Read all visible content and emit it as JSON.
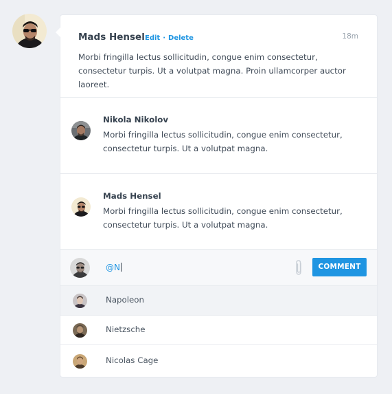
{
  "main_comment": {
    "author": "Mads Hensel",
    "actions": {
      "edit": "Edit",
      "separator": "·",
      "delete": "Delete"
    },
    "time": "18m",
    "text": "Morbi fringilla lectus sollicitudin, congue enim consectetur, consectetur turpis. Ut a volutpat magna. Proin ullamcorper auctor laoreet."
  },
  "replies": [
    {
      "author": "Nikola Nikolov",
      "text": "Morbi fringilla lectus sollicitudin, congue enim consectetur, consectetur turpis. Ut a volutpat magna."
    },
    {
      "author": "Mads Hensel",
      "text": "Morbi fringilla lectus sollicitudin, congue enim consectetur, consectetur turpis. Ut a volutpat magna."
    }
  ],
  "composer": {
    "value": "@N",
    "attach_icon": "paperclip-icon",
    "button_label": "COMMENT"
  },
  "suggestions": [
    {
      "name": "Napoleon",
      "active": true
    },
    {
      "name": "Nietzsche",
      "active": false
    },
    {
      "name": "Nicolas Cage",
      "active": false
    }
  ],
  "colors": {
    "accent": "#1f95e2",
    "background": "#eef0f4",
    "card": "#ffffff",
    "text": "#36424f"
  }
}
